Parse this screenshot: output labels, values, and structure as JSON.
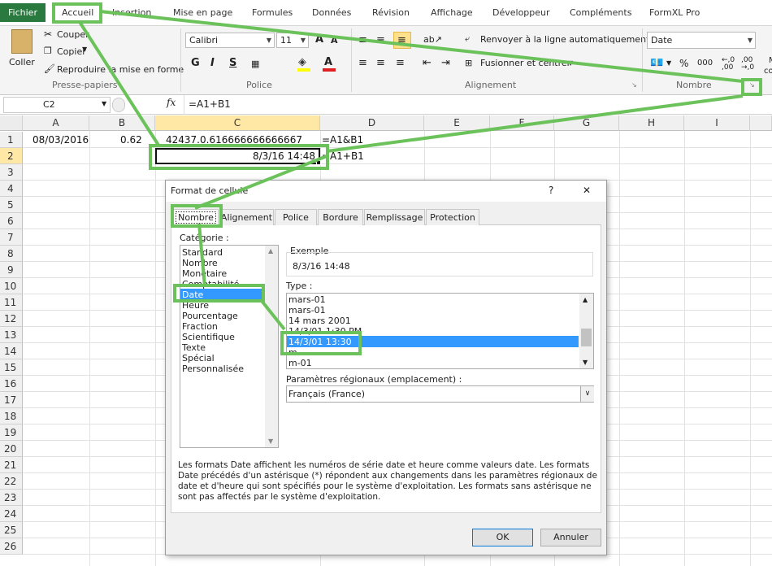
{
  "tabs": {
    "file": "Fichier",
    "items": [
      "Accueil",
      "Insertion",
      "Mise en page",
      "Formules",
      "Données",
      "Révision",
      "Affichage",
      "Développeur",
      "Compléments",
      "FormXL Pro"
    ]
  },
  "ribbon": {
    "clipboard": {
      "paste": "Coller",
      "cut": "Couper",
      "copy": "Copier",
      "format_painter": "Reproduire la mise en forme",
      "group": "Presse-papiers"
    },
    "font": {
      "name": "Calibri",
      "size": "11",
      "group": "Police"
    },
    "alignment": {
      "wrap": "Renvoyer à la ligne automatiquement",
      "merge": "Fusionner et centrer",
      "group": "Alignement"
    },
    "number": {
      "format": "Date",
      "percent": "%",
      "thousands": "000",
      "group": "Nombre"
    }
  },
  "formula_bar": {
    "name_box": "C2",
    "fx": "fx",
    "formula": "=A1+B1"
  },
  "sheet": {
    "columns": [
      "A",
      "B",
      "C",
      "D",
      "E",
      "F",
      "G",
      "H",
      "I"
    ],
    "rows": [
      "1",
      "2",
      "3",
      "4",
      "5",
      "6",
      "7",
      "8",
      "9",
      "10",
      "11",
      "12",
      "13",
      "14",
      "15",
      "16",
      "17",
      "18",
      "19",
      "20",
      "21",
      "22",
      "23",
      "24",
      "25",
      "26"
    ],
    "cells": {
      "A1": "08/03/2016",
      "B1": "0.62",
      "C1": "42437.0.616666666666667",
      "D1": "=A1&B1",
      "C2": "8/3/16 14:48",
      "D2": "=A1+B1"
    }
  },
  "dialog": {
    "title": "Format de cellule",
    "help": "?",
    "close": "✕",
    "tabs": [
      "Nombre",
      "Alignement",
      "Police",
      "Bordure",
      "Remplissage",
      "Protection"
    ],
    "category_label": "Catégorie :",
    "categories": [
      "Standard",
      "Nombre",
      "Monétaire",
      "Comptabilité",
      "Date",
      "Heure",
      "Pourcentage",
      "Fraction",
      "Scientifique",
      "Texte",
      "Spécial",
      "Personnalisée"
    ],
    "selected_category": "Date",
    "sample_label": "Exemple",
    "sample_value": "8/3/16 14:48",
    "type_label": "Type :",
    "types": [
      "mars-01",
      "mars-01",
      "14 mars 2001",
      "14/3/01 1:30 PM",
      "14/3/01 13:30",
      "m",
      "m-01"
    ],
    "selected_type": "14/3/01 13:30",
    "locale_label": "Paramètres régionaux (emplacement) :",
    "locale_value": "Français (France)",
    "description": "Les formats Date affichent les numéros de série date et heure comme valeurs date. Les formats Date précédés d'un astérisque (*) répondent aux changements dans les paramètres régionaux de date et d'heure qui sont spécifiés pour le système d'exploitation. Les formats sans astérisque ne sont pas affectés par le système d'exploitation.",
    "ok": "OK",
    "cancel": "Annuler"
  },
  "colors": {
    "file_tab": "#2a7a3f",
    "highlight": "#6cc25a",
    "selection": "#3399ff"
  }
}
